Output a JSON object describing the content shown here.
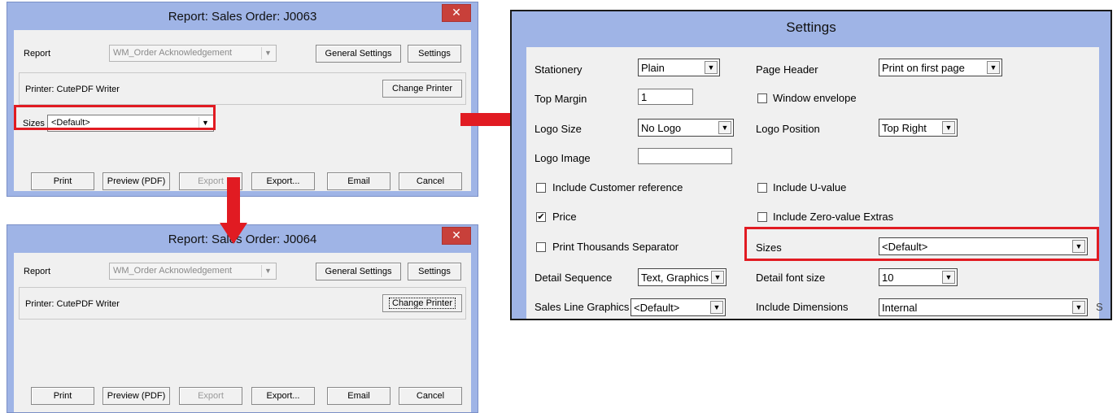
{
  "dialog1": {
    "title": "Report: Sales Order: J0063",
    "close_glyph": "✕",
    "report_label": "Report",
    "report_value": "WM_Order Acknowledgement",
    "general_settings": "General Settings",
    "settings": "Settings",
    "printer_text": "Printer: CutePDF Writer",
    "change_printer": "Change Printer",
    "sizes_label": "Sizes",
    "sizes_value": "<Default>",
    "buttons": [
      "Print",
      "Preview (PDF)",
      "Export",
      "Export...",
      "Email",
      "Cancel"
    ]
  },
  "dialog2": {
    "title": "Report: Sales Order: J0064",
    "close_glyph": "✕",
    "report_label": "Report",
    "report_value": "WM_Order Acknowledgement",
    "general_settings": "General Settings",
    "settings": "Settings",
    "printer_text": "Printer: CutePDF Writer",
    "change_printer": "Change Printer",
    "buttons": [
      "Print",
      "Preview (PDF)",
      "Export",
      "Export...",
      "Email",
      "Cancel"
    ]
  },
  "settings_panel": {
    "title": "Settings",
    "stationery_label": "Stationery",
    "stationery_value": "Plain",
    "page_header_label": "Page Header",
    "page_header_value": "Print on first page",
    "top_margin_label": "Top Margin",
    "top_margin_value": "1",
    "window_envelope_label": "Window envelope",
    "window_envelope_checked": false,
    "logo_size_label": "Logo Size",
    "logo_size_value": "No Logo",
    "logo_position_label": "Logo Position",
    "logo_position_value": "Top Right",
    "logo_image_label": "Logo Image",
    "logo_image_value": "",
    "include_customer_reference_label": "Include Customer reference",
    "include_customer_reference_checked": false,
    "include_u_value_label": "Include U-value",
    "include_u_value_checked": false,
    "price_label": "Price",
    "price_checked": true,
    "include_zero_value_extras_label": "Include Zero-value Extras",
    "include_zero_value_extras_checked": false,
    "print_thousands_separator_label": "Print Thousands Separator",
    "print_thousands_separator_checked": false,
    "sizes_label": "Sizes",
    "sizes_value": "<Default>",
    "detail_sequence_label": "Detail Sequence",
    "detail_sequence_value": "Text, Graphics",
    "detail_font_size_label": "Detail font size",
    "detail_font_size_value": "10",
    "sales_line_graphics_label": "Sales Line Graphics",
    "sales_line_graphics_value": "<Default>",
    "include_dimensions_label": "Include Dimensions",
    "include_dimensions_value": "Internal",
    "cut_off_char": "S"
  },
  "glyphs": {
    "dropdown_arrow": "▼",
    "check_mark": "✔"
  },
  "colors": {
    "highlight_red": "#e11b22",
    "title_blue": "#9fb4e6",
    "close_red": "#c8403a"
  }
}
